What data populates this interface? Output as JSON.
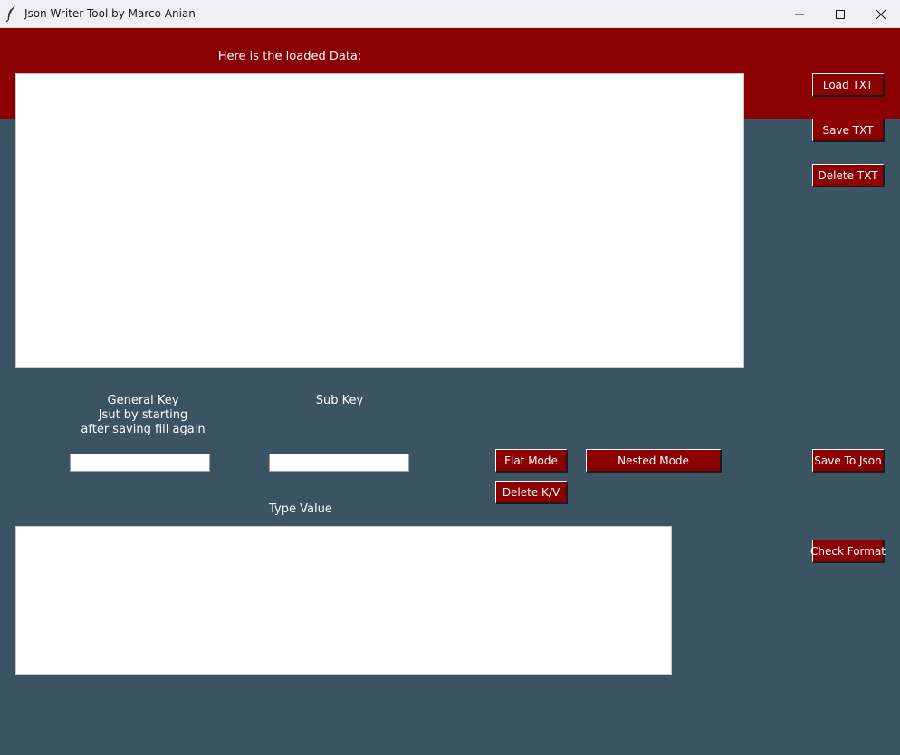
{
  "window": {
    "title": "Json Writer Tool by Marco Anian",
    "controls": [
      "minimize-icon",
      "maximize-icon",
      "close-icon"
    ]
  },
  "colors": {
    "background": "#3a5463",
    "accent": "#8b0000",
    "text": "#ffffff"
  },
  "data_panel": {
    "label": "Here is the loaded Data:",
    "content": ""
  },
  "file_buttons": {
    "load": "Load TXT",
    "save": "Save TXT",
    "delete": "Delete TXT"
  },
  "keys": {
    "general_label": "General Key\nJsut by starting\nafter saving fill again",
    "general_value": "",
    "sub_label": "Sub Key",
    "sub_value": ""
  },
  "mode_buttons": {
    "flat": "Flat Mode",
    "nested": "Nested Mode",
    "delete_kv": "Delete K/V"
  },
  "value_panel": {
    "label": "Type Value",
    "content": ""
  },
  "json_buttons": {
    "save_json": "Save To Json",
    "check_format": "Check Format"
  }
}
